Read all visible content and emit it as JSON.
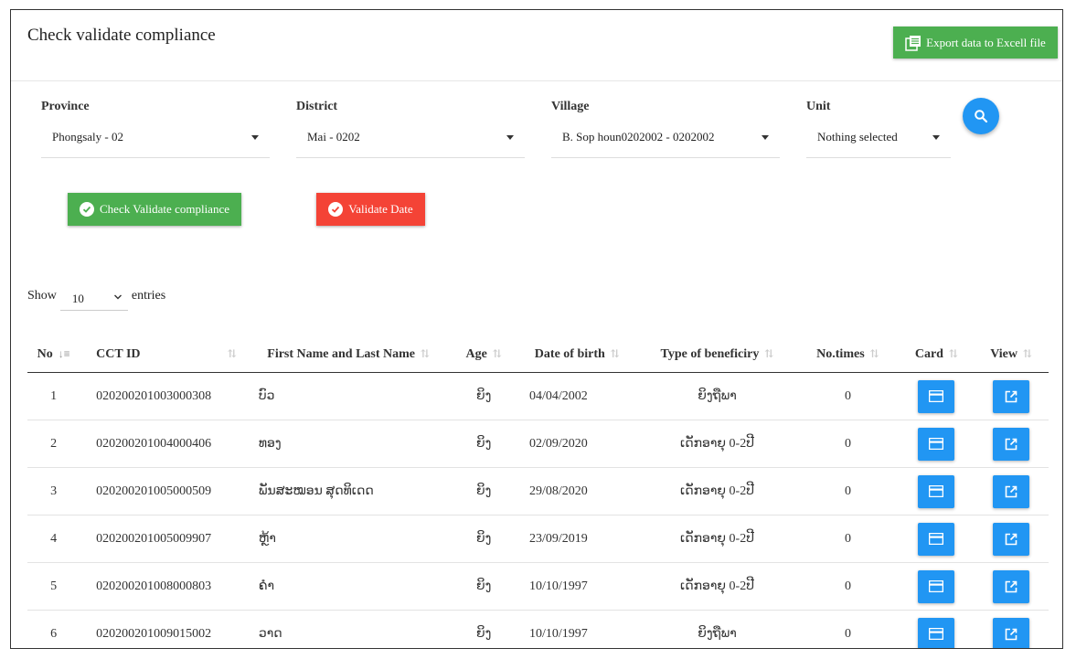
{
  "header": {
    "title": "Check validate compliance",
    "export_label": "Export data to Excell file"
  },
  "filters": {
    "province": {
      "label": "Province",
      "value": "Phongsaly - 02"
    },
    "district": {
      "label": "District",
      "value": "Mai - 0202"
    },
    "village": {
      "label": "Village",
      "value": "B. Sop houn0202002 - 0202002"
    },
    "unit": {
      "label": "Unit",
      "value": "Nothing selected"
    }
  },
  "actions": {
    "check_label": "Check Validate compliance",
    "validate_label": "Validate Date"
  },
  "entries": {
    "show": "Show",
    "value": "10",
    "suffix": "entries"
  },
  "table": {
    "headers": [
      "No",
      "CCT ID",
      "First Name and Last Name",
      "Age",
      "Date of birth",
      "Type of beneficiry",
      "No.times",
      "Card",
      "View"
    ],
    "rows": [
      {
        "no": "1",
        "cct": "0202002010030003 08",
        "name": "ບົວ",
        "age": "ຍິງ",
        "dob": "04/04/2002",
        "type": "ຍິງຖືພາ",
        "times": "0"
      },
      {
        "no": "2",
        "cct": "020200201004000406",
        "name": "ທອງ",
        "age": "ຍິງ",
        "dob": "02/09/2020",
        "type": "ເດັກອາຍຸ 0-2ປີ",
        "times": "0"
      },
      {
        "no": "3",
        "cct": "020200201005000509",
        "name": "ພັນສະໝອນ ສຸດທິເດດ",
        "age": "ຍິງ",
        "dob": "29/08/2020",
        "type": "ເດັກອາຍຸ 0-2ປີ",
        "times": "0"
      },
      {
        "no": "4",
        "cct": "020200201005009907",
        "name": "ຫຼ້າ",
        "age": "ຍິງ",
        "dob": "23/09/2019",
        "type": "ເດັກອາຍຸ 0-2ປີ",
        "times": "0"
      },
      {
        "no": "5",
        "cct": "020200201008000803",
        "name": "ຄຳ",
        "age": "ຍິງ",
        "dob": "10/10/1997",
        "type": "ເດັກອາຍຸ 0-2ປີ",
        "times": "0"
      },
      {
        "no": "6",
        "cct": "020200201009015002",
        "name": "ວາດ",
        "age": "ຍິງ",
        "dob": "10/10/1997",
        "type": "ຍິງຖືພາ",
        "times": "0"
      }
    ]
  },
  "colors": {
    "green": "#4caf50",
    "red": "#f44336",
    "blue": "#2196f3"
  },
  "icons": {
    "export": "spreadsheet-icon",
    "search": "search-icon",
    "check": "check-circle-icon",
    "card": "credit-card-icon",
    "view": "open-in-new-icon"
  }
}
